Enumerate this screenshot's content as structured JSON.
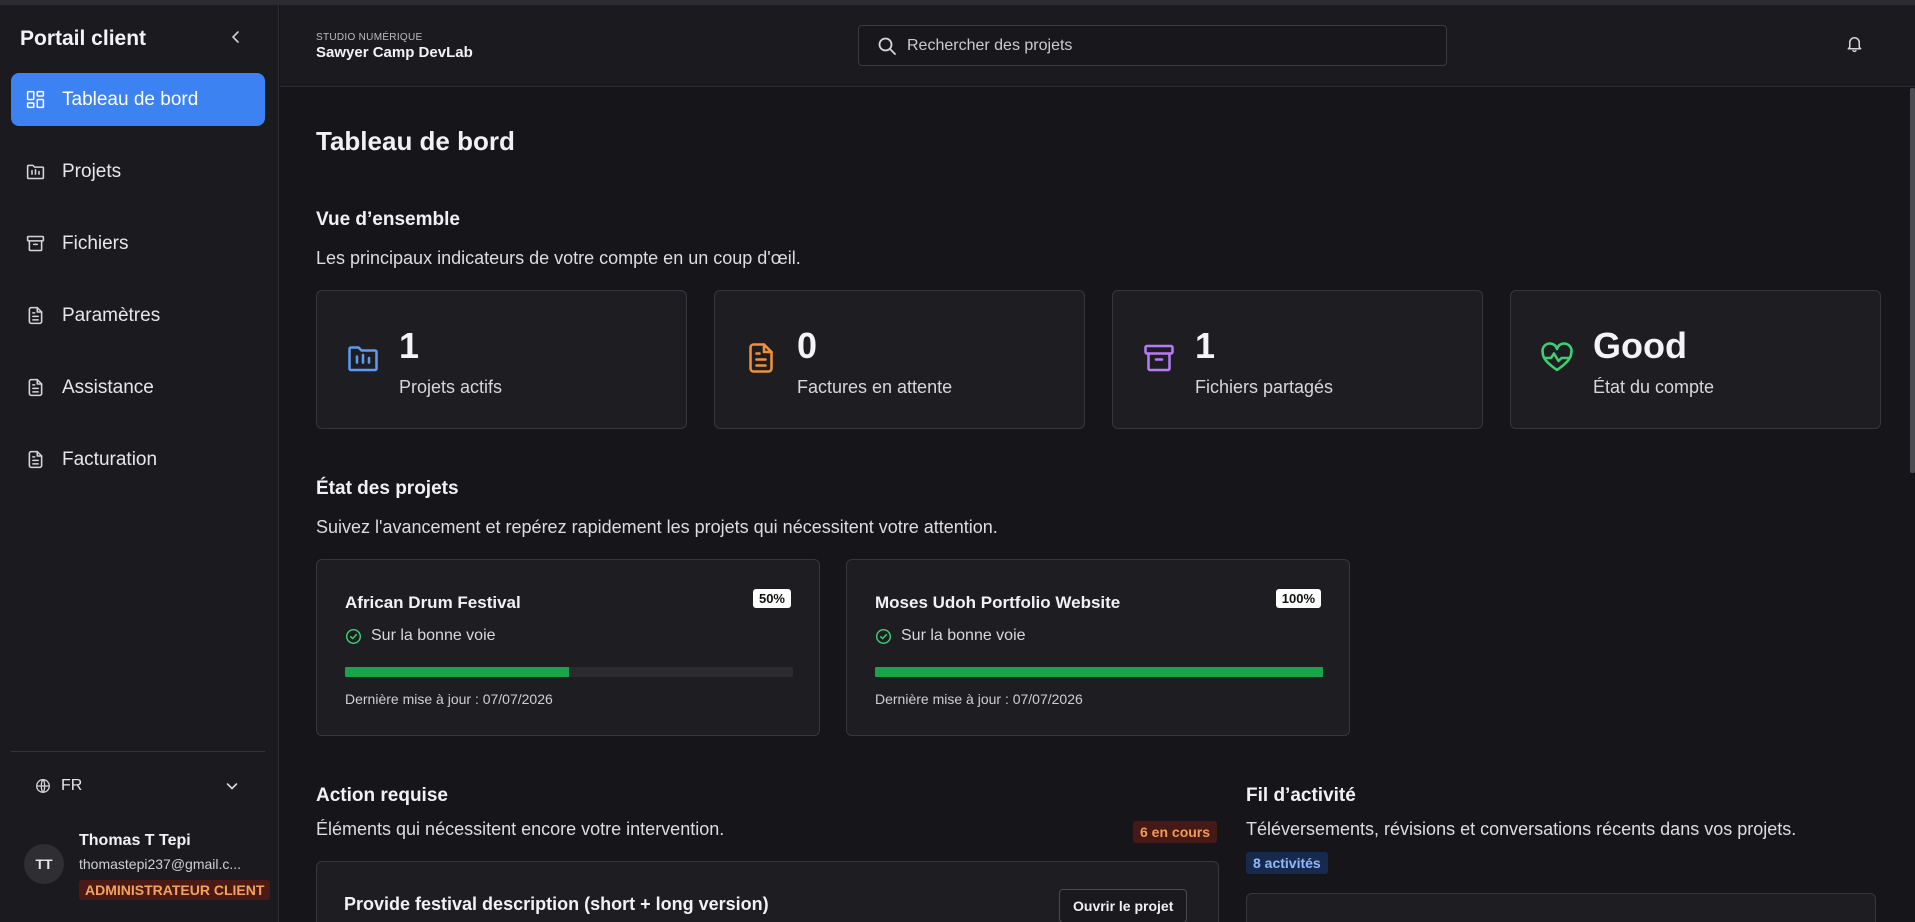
{
  "sidebar": {
    "brand": "Portail client",
    "items": [
      {
        "label": "Tableau de bord",
        "icon": "dashboard-icon",
        "active": true
      },
      {
        "label": "Projets",
        "icon": "folder-icon"
      },
      {
        "label": "Fichiers",
        "icon": "archive-icon"
      },
      {
        "label": "Paramètres",
        "icon": "document-icon"
      },
      {
        "label": "Assistance",
        "icon": "document-icon"
      },
      {
        "label": "Facturation",
        "icon": "document-icon"
      }
    ],
    "language": "FR",
    "user": {
      "initials": "TT",
      "name": "Thomas T Tepi",
      "email": "thomastepi237@gmail.c...",
      "role": "ADMINISTRATEUR CLIENT"
    }
  },
  "header": {
    "studio_label": "STUDIO NUMÉRIQUE",
    "studio_name": "Sawyer Camp DevLab",
    "search_placeholder": "Rechercher des projets"
  },
  "main": {
    "title": "Tableau de bord",
    "overview": {
      "title": "Vue d’ensemble",
      "description": "Les principaux indicateurs de votre compte en un coup d'œil.",
      "stats": [
        {
          "value": "1",
          "label": "Projets actifs",
          "color": "#5b9bf2",
          "icon": "folder-icon"
        },
        {
          "value": "0",
          "label": "Factures en attente",
          "color": "#f0913a",
          "icon": "document-icon"
        },
        {
          "value": "1",
          "label": "Fichiers partagés",
          "color": "#b77cf2",
          "icon": "archive-icon"
        },
        {
          "value": "Good",
          "label": "État du compte",
          "color": "#3ecf75",
          "icon": "heart-pulse-icon"
        }
      ]
    },
    "projects_status": {
      "title": "État des projets",
      "description": "Suivez l'avancement et repérez rapidement les projets qui nécessitent votre attention.",
      "projects": [
        {
          "name": "African Drum Festival",
          "percent_label": "50%",
          "progress": 0.5,
          "status": "Sur la bonne voie",
          "updated": "Dernière mise à jour : 07/07/2026"
        },
        {
          "name": "Moses Udoh Portfolio Website",
          "percent_label": "100%",
          "progress": 1.0,
          "status": "Sur la bonne voie",
          "updated": "Dernière mise à jour : 07/07/2026"
        }
      ]
    },
    "action_required": {
      "title": "Action requise",
      "description": "Éléments qui nécessitent encore votre intervention.",
      "badge": "6 en cours",
      "first_item": {
        "title": "Provide festival description (short + long version)",
        "button": "Ouvrir le projet"
      }
    },
    "activity_feed": {
      "title": "Fil d’activité",
      "description": "Téléversements, révisions et conversations récents dans vos projets.",
      "badge": "8 activités"
    }
  }
}
